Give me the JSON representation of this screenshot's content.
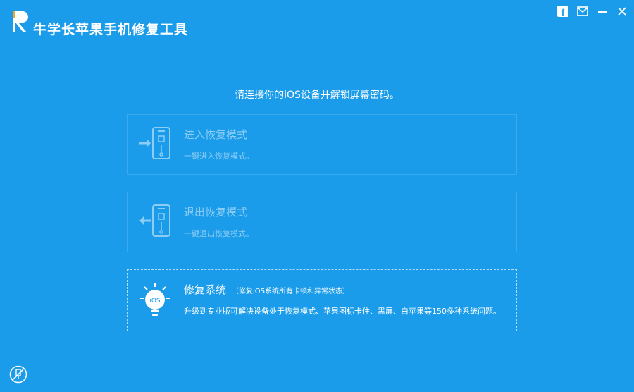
{
  "app": {
    "logo_letter": "R",
    "title": "牛学长苹果手机修复工具"
  },
  "window_controls": {
    "icons": [
      "facebook-icon",
      "mail-icon",
      "minimize-icon",
      "close-icon"
    ],
    "facebook_glyph": "f"
  },
  "main": {
    "prompt": "请连接你的iOS设备并解锁屏幕密码。",
    "cards": [
      {
        "title": "进入恢复模式",
        "subtitle": "一键进入恢复模式。",
        "icon": "enter-recovery-icon",
        "enabled": false
      },
      {
        "title": "退出恢复模式",
        "subtitle": "一键退出恢复模式。",
        "icon": "exit-recovery-icon",
        "enabled": false
      },
      {
        "title": "修复系统",
        "hint": "（修复iOS系统所有卡顿和异常状态）",
        "subtitle": "升级到专业版可解决设备处于恢复模式、苹果图标卡住、黑屏、白苹果等150多种系统问题。",
        "icon": "ios-bulb-icon",
        "badge": "iOS",
        "enabled": true
      }
    ]
  },
  "colors": {
    "background": "#1a9cea",
    "text": "#ffffff",
    "logo_accent": "#f5a623"
  }
}
